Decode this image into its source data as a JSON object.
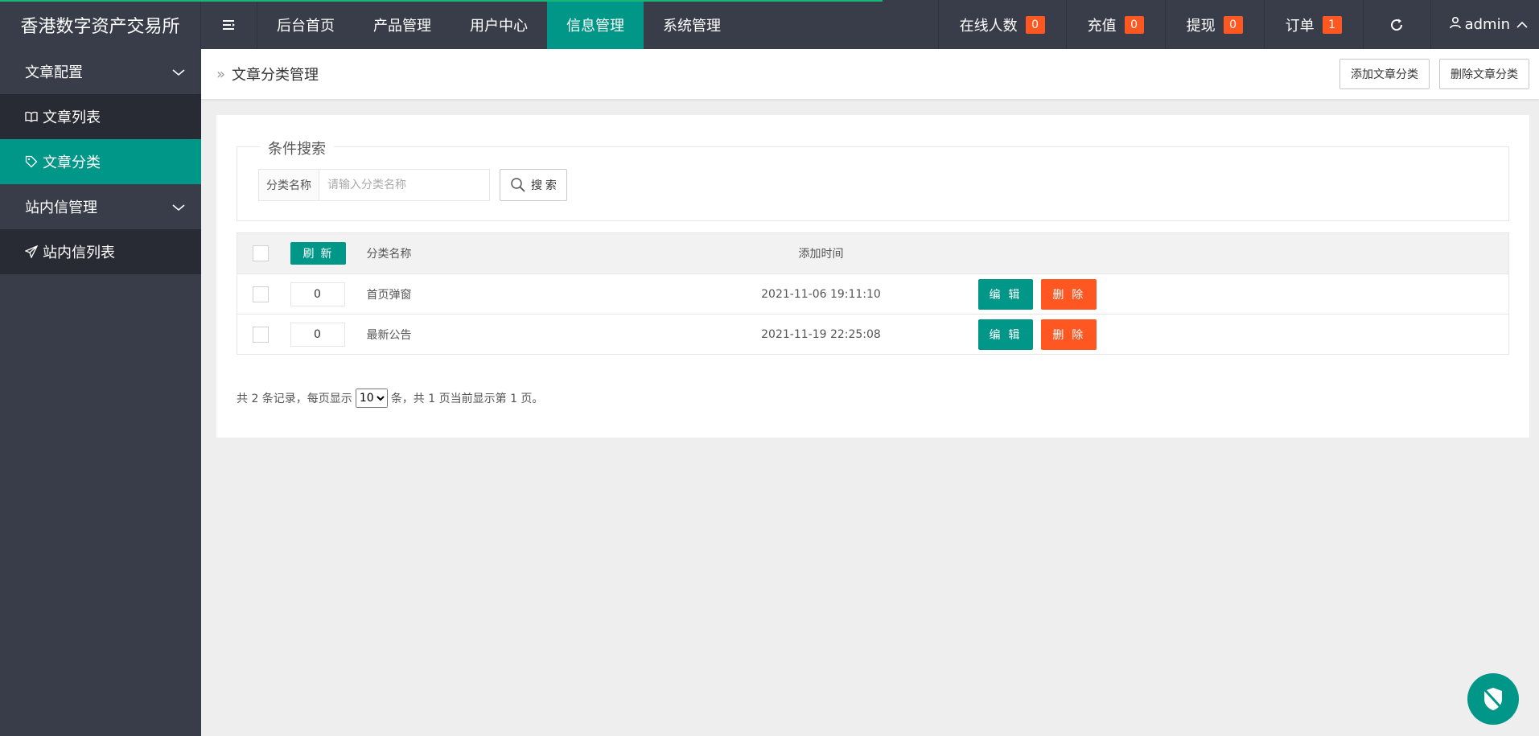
{
  "brand": "香港数字资产交易所",
  "nav": [
    {
      "label": "后台首页"
    },
    {
      "label": "产品管理"
    },
    {
      "label": "用户中心"
    },
    {
      "label": "信息管理"
    },
    {
      "label": "系统管理"
    }
  ],
  "topright": {
    "online": {
      "label": "在线人数",
      "count": "0"
    },
    "recharge": {
      "label": "充值",
      "count": "0"
    },
    "withdraw": {
      "label": "提现",
      "count": "0"
    },
    "orders": {
      "label": "订单",
      "count": "1"
    },
    "user": "admin"
  },
  "sidebar": {
    "group1": "文章配置",
    "items1": [
      {
        "label": "文章列表"
      },
      {
        "label": "文章分类"
      }
    ],
    "group2": "站内信管理",
    "items2": [
      {
        "label": "站内信列表"
      }
    ]
  },
  "breadcrumb": "文章分类管理",
  "actions": {
    "add": "添加文章分类",
    "delete": "删除文章分类"
  },
  "search": {
    "legend": "条件搜索",
    "field_label": "分类名称",
    "placeholder": "请输入分类名称",
    "button": "搜 索"
  },
  "table": {
    "refresh": "刷 新",
    "col_name": "分类名称",
    "col_time": "添加时间",
    "rows": [
      {
        "order": "0",
        "name": "首页弹窗",
        "time": "2021-11-06 19:11:10"
      },
      {
        "order": "0",
        "name": "最新公告",
        "time": "2021-11-19 22:25:08"
      }
    ],
    "edit_label": "编 辑",
    "delete_label": "删 除"
  },
  "pager": {
    "prefix": "共 2 条记录，每页显示",
    "per_page": "10",
    "suffix": "条，共 1 页当前显示第 1 页。"
  },
  "colors": {
    "accent": "#009688",
    "danger": "#ff5722",
    "dark": "#393d49"
  }
}
